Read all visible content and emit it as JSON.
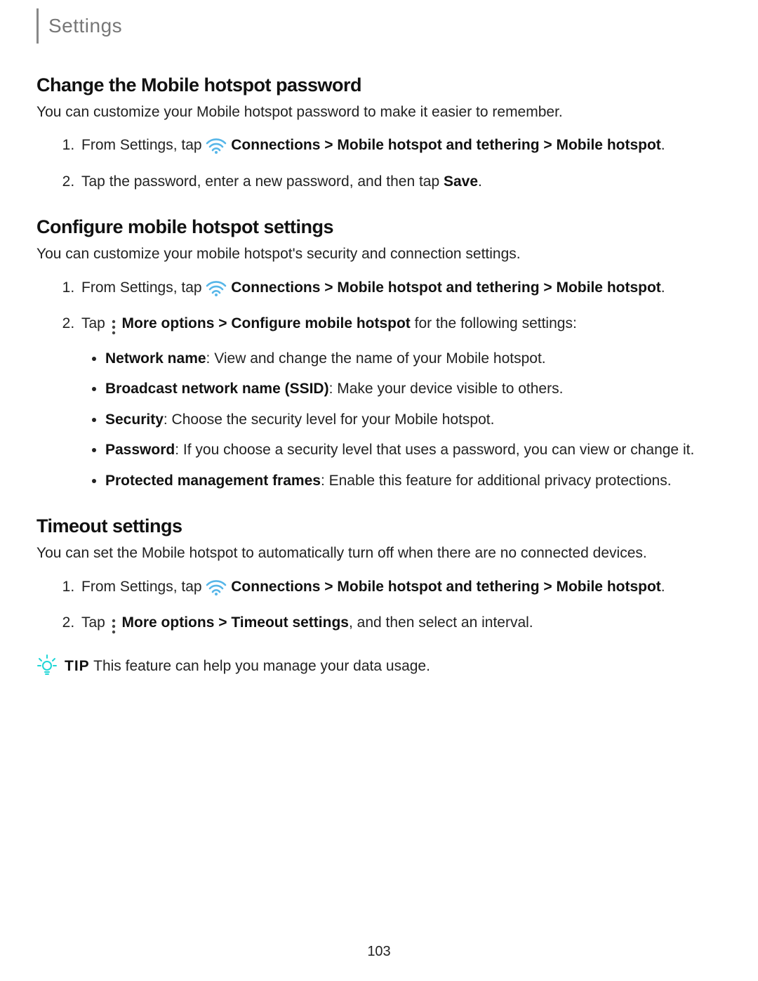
{
  "header": {
    "title": "Settings"
  },
  "page_number": "103",
  "common": {
    "from_settings_tap": "From Settings, tap ",
    "connections": "Connections",
    "sep": " > ",
    "mobile_hotspot_tethering": "Mobile hotspot and tethering",
    "mobile_hotspot": "Mobile hotspot",
    "period": ".",
    "tap": "Tap ",
    "more_options": "More options",
    "configure_mobile_hotspot": "Configure mobile hotspot",
    "for_following": " for the following settings:"
  },
  "sections": {
    "change_pw": {
      "title": "Change the Mobile hotspot password",
      "intro": "You can customize your Mobile hotspot password to make it easier to remember.",
      "step2_pre": "Tap the password, enter a new password, and then tap ",
      "step2_bold": "Save",
      "step2_post": "."
    },
    "configure": {
      "title": "Configure mobile hotspot settings",
      "intro": "You can customize your mobile hotspot's security and connection settings.",
      "bullets": [
        {
          "label": "Network name",
          "text": ": View and change the name of your Mobile hotspot."
        },
        {
          "label": "Broadcast network name (SSID)",
          "text": ": Make your device visible to others."
        },
        {
          "label": "Security",
          "text": ": Choose the security level for your Mobile hotspot."
        },
        {
          "label": "Password",
          "text": ": If you choose a security level that uses a password, you can view or change it."
        },
        {
          "label": "Protected management frames",
          "text": ": Enable this feature for additional privacy protections."
        }
      ]
    },
    "timeout": {
      "title": "Timeout settings",
      "intro": "You can set the Mobile hotspot to automatically turn off when there are no connected devices.",
      "step2_mid": "Timeout settings",
      "step2_post": ", and then select an interval."
    }
  },
  "tip": {
    "label": "TIP",
    "text": " This feature can help you manage your data usage."
  }
}
